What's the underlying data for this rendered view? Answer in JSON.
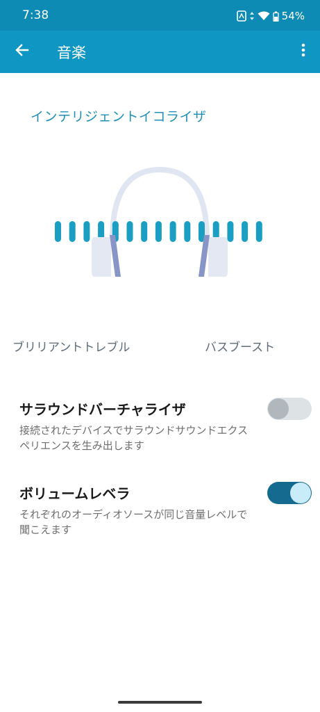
{
  "status": {
    "time": "7:38",
    "battery": "54%",
    "icons": [
      "nfc-icon",
      "data-arrows-icon",
      "wifi-icon",
      "battery-icon"
    ]
  },
  "appbar": {
    "title": "音楽",
    "back_icon": "arrow-left-icon",
    "more_icon": "more-vert-icon"
  },
  "equalizer": {
    "title": "インテリジェントイコライザ",
    "bar_count": 15,
    "left_label": "ブリリアントトレブル",
    "right_label": "バスブースト",
    "accent": "#1a9ec2"
  },
  "settings": [
    {
      "title": "サラウンドバーチャライザ",
      "desc": "接続されたデバイスでサラウンドサウンドエクスペリエンスを生み出します",
      "enabled": false
    },
    {
      "title": "ボリュームレベラ",
      "desc": "それぞれのオーディオソースが同じ音量レベルで聞こえます",
      "enabled": true
    }
  ],
  "colors": {
    "statusbar": "#0e8bb4",
    "appbar": "#0f96c2",
    "toggle_on": "#156b8f"
  }
}
